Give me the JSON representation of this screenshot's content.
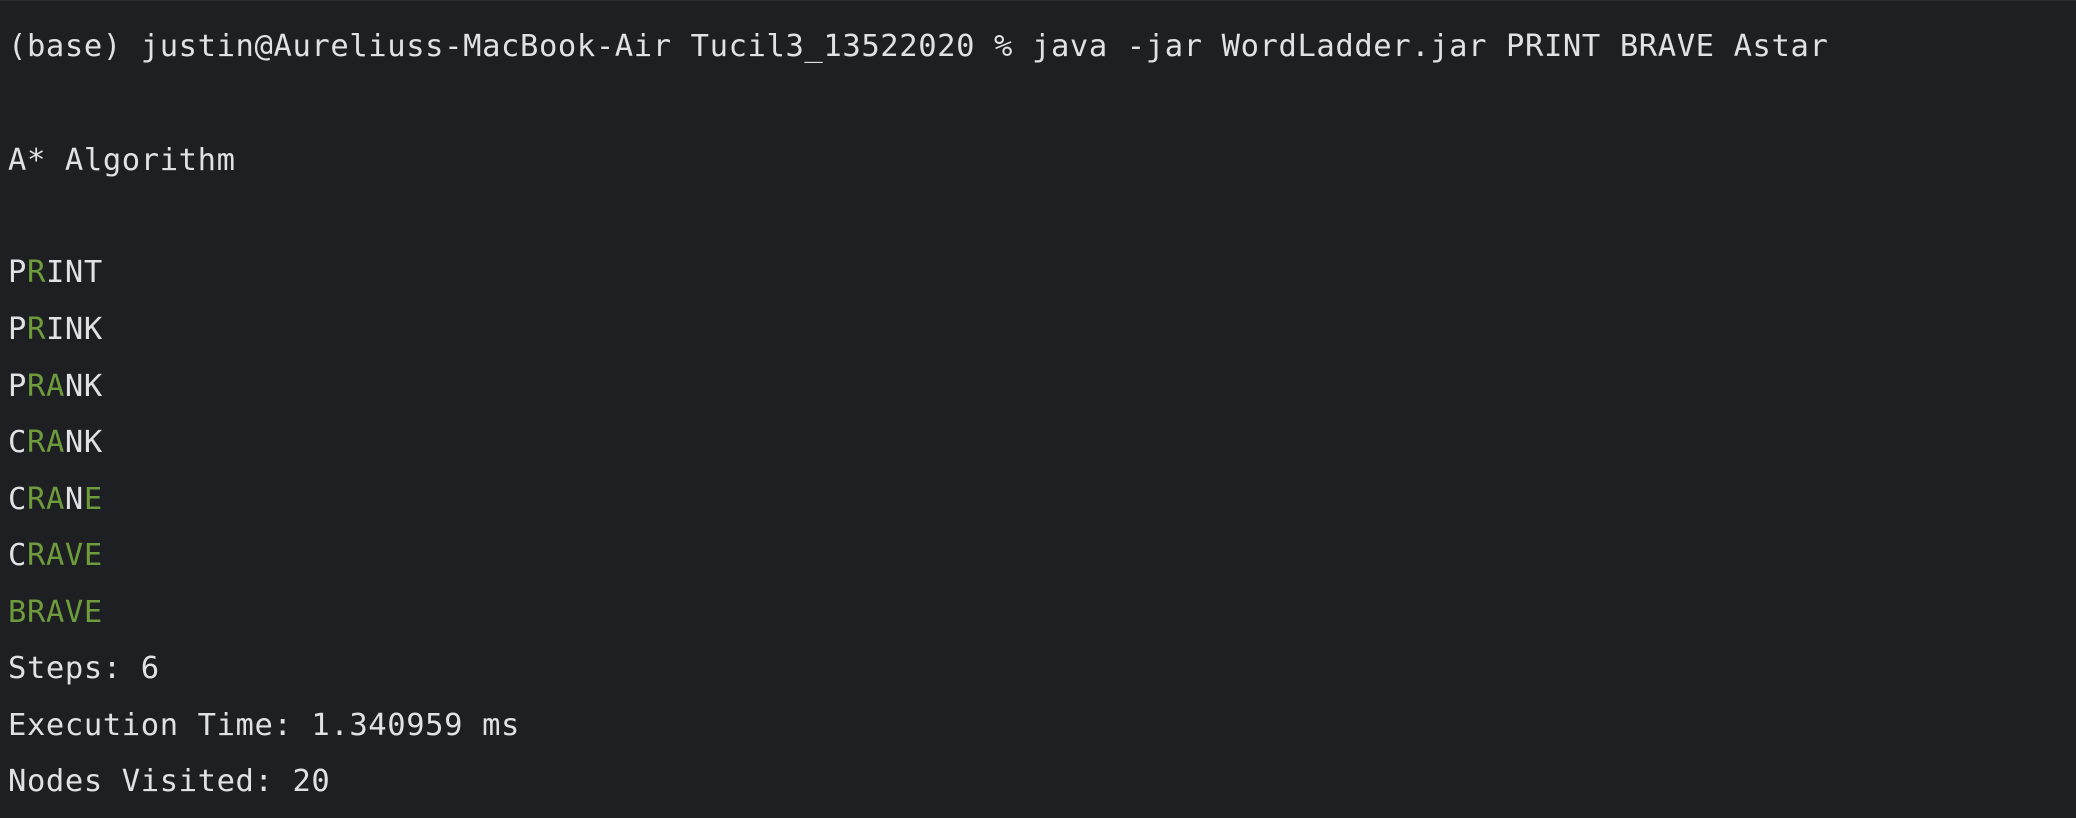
{
  "terminal": {
    "command_line": "(base) justin@Aureliuss-MacBook-Air Tucil3_13522020 % java -jar WordLadder.jar PRINT BRAVE Astar",
    "algorithm_label": "A* Algorithm",
    "match_color": "#6e9b3c",
    "text_color": "#dfe1e5",
    "background_color": "#1e1f22",
    "ladder": [
      {
        "word": "PRINT",
        "highlight": [
          false,
          true,
          false,
          false,
          false
        ]
      },
      {
        "word": "PRINK",
        "highlight": [
          false,
          true,
          false,
          false,
          false
        ]
      },
      {
        "word": "PRANK",
        "highlight": [
          false,
          true,
          true,
          false,
          false
        ]
      },
      {
        "word": "CRANK",
        "highlight": [
          false,
          true,
          true,
          false,
          false
        ]
      },
      {
        "word": "CRANE",
        "highlight": [
          false,
          true,
          true,
          false,
          true
        ]
      },
      {
        "word": "CRAVE",
        "highlight": [
          false,
          true,
          true,
          true,
          true
        ]
      },
      {
        "word": "BRAVE",
        "highlight": [
          true,
          true,
          true,
          true,
          true
        ]
      }
    ],
    "steps_line": "Steps: 6",
    "execution_time_line": "Execution Time: 1.340959 ms",
    "nodes_visited_line": "Nodes Visited: 20"
  }
}
